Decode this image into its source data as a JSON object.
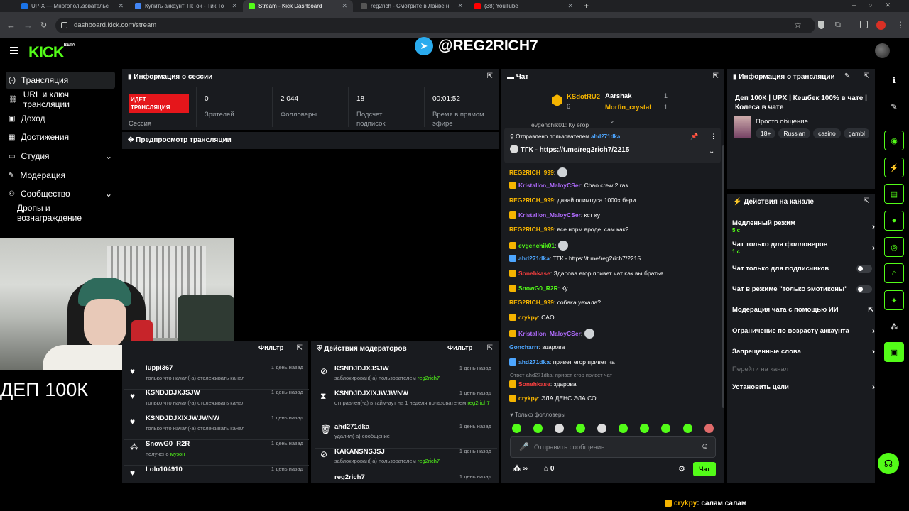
{
  "browser": {
    "tabs": [
      {
        "title": "UP-X — Многопользовательс",
        "icon": "upx-favicon",
        "color": "#1a73e8"
      },
      {
        "title": "Купить аккаунт TikTok - Тик То",
        "icon": "f-favicon",
        "color": "#4285f4"
      },
      {
        "title": "Stream - Kick Dashboard",
        "icon": "kick-favicon",
        "color": "#53fc18"
      },
      {
        "title": "reg2rich - Смотрите в Лайве н",
        "icon": "kick-favicon",
        "color": "#222"
      },
      {
        "title": "(38) YouTube",
        "icon": "youtube-favicon",
        "color": "#ff0000"
      }
    ],
    "url": "dashboard.kick.com/stream"
  },
  "brand": {
    "logo": "KICK",
    "beta": "BETA",
    "accent": "#53fc18"
  },
  "overlay_handle": "@REG2RICH7",
  "sidebar": {
    "items": [
      {
        "label": "Трансляция",
        "icon": "broadcast-icon"
      },
      {
        "label": "URL и ключ трансляции",
        "icon": "link-icon"
      },
      {
        "label": "Доход",
        "icon": "money-icon"
      },
      {
        "label": "Достижения",
        "icon": "achievements-icon"
      },
      {
        "label": "Студия",
        "icon": "studio-icon"
      },
      {
        "label": "Модерация",
        "icon": "moderation-icon"
      },
      {
        "label": "Сообщество",
        "icon": "community-icon"
      },
      {
        "label": "Дропы и вознаграждение",
        "icon": ""
      }
    ]
  },
  "session": {
    "title": "Информация о сессии",
    "live_badge": "ИДЕТ ТРАНСЛЯЦИЯ",
    "session_label": "Сессия",
    "stats": [
      {
        "value": "0",
        "label": "Зрителей"
      },
      {
        "value": "2 044",
        "label": "Фолловеры"
      },
      {
        "value": "18",
        "label": "Подсчет подписок"
      },
      {
        "value": "00:01:52",
        "label": "Время в прямом эфире"
      }
    ]
  },
  "preview": {
    "title": "Предпросмотр трансляции"
  },
  "webcam_caption": "ДЕП 100К",
  "activity": {
    "filter": "Фильтр",
    "items": [
      {
        "name": "luppi367",
        "desc": "только что начал(-а) отслеживать канал",
        "time": "1 день назад",
        "icon": "heart-icon"
      },
      {
        "name": "KSNDJDJXJSJW",
        "desc": "только что начал(-а) отслеживать канал",
        "time": "1 день назад",
        "icon": "heart-icon"
      },
      {
        "name": "KSNDJDJXIXJWJWNW",
        "desc": "только что начал(-а) отслеживать канал",
        "time": "1 день назад",
        "icon": "heart-icon"
      },
      {
        "name": "SnowG0_R2R",
        "desc": "получено",
        "desc_hl": "музон",
        "time": "1 день назад",
        "icon": "gift-icon"
      },
      {
        "name": "Lolo104910",
        "desc": "",
        "time": "1 день назад",
        "icon": "heart-icon"
      }
    ]
  },
  "mod_actions": {
    "title": "Действия модераторов",
    "filter": "Фильтр",
    "items": [
      {
        "name": "KSNDJDJXJSJW",
        "desc": "заблокирован(-а) пользователем",
        "who": "reg2rich7",
        "time": "1 день назад",
        "icon": "ban-icon"
      },
      {
        "name": "KSNDJDJXIXJWJWNW",
        "desc": "отправлен(-а) в тайм-аут на 1 неделя пользователем",
        "who": "reg2rich7",
        "time": "1 день назад",
        "icon": "hourglass-icon"
      },
      {
        "name": "ahd271dka",
        "desc": "удалил(-а) сообщение",
        "who": "",
        "time": "1 день назад",
        "icon": "trash-icon"
      },
      {
        "name": "KAKANSNSJSJ",
        "desc": "заблокирован(-а) пользователем",
        "who": "reg2rich7",
        "time": "1 день назад",
        "icon": "ban-icon"
      },
      {
        "name": "reg2rich7",
        "desc": "",
        "who": "",
        "time": "1 день назад",
        "icon": "ban-icon"
      }
    ]
  },
  "chat": {
    "title": "Чат",
    "leaders": [
      {
        "name": "KSdotRU2",
        "count": "6",
        "extra": ""
      },
      {
        "name": "Aarshak",
        "count": "",
        "extra": "1"
      },
      {
        "name": "Morfin_crystal",
        "count": "",
        "extra": "1"
      }
    ],
    "pinned": {
      "label": "Отправлено пользователем",
      "user": "ahd271dka",
      "text": "ТГК - ",
      "link": "https://t.me/reg2rich7/2215"
    },
    "cut_top": "evgenchik01: Ку егор",
    "messages": [
      {
        "user": "REG2RICH_999",
        "cls": "u-y",
        "text": ""
      },
      {
        "user": "Kristallon_MaloyCSer",
        "cls": "u-p",
        "text": "Chao crew 2 газ"
      },
      {
        "user": "REG2RICH_999",
        "cls": "u-y",
        "text": "давай олимпуса 1000x бери"
      },
      {
        "user": "Kristallon_MaloyCSer",
        "cls": "u-p",
        "text": "кст ку"
      },
      {
        "user": "REG2RICH_999",
        "cls": "u-y",
        "text": "все норм вроде, сам как?"
      },
      {
        "user": "evgenchik01",
        "cls": "u-g",
        "text": ""
      },
      {
        "user": "ahd271dka",
        "cls": "u-b",
        "text": "ТГК - https://t.me/reg2rich7/2215"
      },
      {
        "user": "Sonehkase",
        "cls": "u-r",
        "text": "Здарова егор привет чат как вы братья"
      },
      {
        "user": "SnowG0_R2R",
        "cls": "u-g",
        "text": "Ку"
      },
      {
        "user": "REG2RICH_999",
        "cls": "u-y",
        "text": "собака уехала?"
      },
      {
        "user": "crykpy",
        "cls": "u-y",
        "text": "CAO"
      },
      {
        "user": "Kristallon_MaloyCSer",
        "cls": "u-p",
        "text": ""
      },
      {
        "user": "Goncharrr",
        "cls": "u-b",
        "text": "здарова"
      },
      {
        "user": "ahd271dka",
        "cls": "u-b",
        "text": "привет егор привет чат"
      },
      {
        "user": "Sonehkase",
        "cls": "u-r",
        "text": "здарова"
      },
      {
        "user": "crykpy",
        "cls": "u-y",
        "text": "ЭЛА ДЕНС ЭЛА СО"
      }
    ],
    "reply_ref": "Ответ ahd271dka: привет егор привет чат",
    "followers_only": "Только фолловеры",
    "input_placeholder": "Отправить сообщение",
    "infinity_count": "∞",
    "chest_count": "0",
    "send_label": "Чат"
  },
  "stream_info": {
    "title": "Информация о трансляции",
    "stream_title": "Деп 100К | UPX | Кешбек 100% в чате | Колеса в чате",
    "category": "Просто общение",
    "tags": [
      "18+",
      "Russian",
      "casino",
      "gambl"
    ]
  },
  "channel_actions": {
    "title": "Действия на канале",
    "items": [
      {
        "label": "Медленный режим",
        "sub": "5 с",
        "control": "chevron"
      },
      {
        "label": "Чат только для фолловеров",
        "sub": "1 с",
        "control": "chevron"
      },
      {
        "label": "Чат только для подписчиков",
        "sub": "",
        "control": "toggle"
      },
      {
        "label": "Чат в режиме \"только эмотиконы\"",
        "sub": "",
        "control": "toggle"
      },
      {
        "label": "Модерация чата с помощью ИИ",
        "sub": "",
        "control": "external"
      },
      {
        "label": "Ограничение по возрасту аккаунта",
        "sub": "",
        "control": "chevron"
      },
      {
        "label": "Запрещенные слова",
        "sub": "",
        "control": "chevron"
      },
      {
        "label": "Перейти на канал",
        "sub": "",
        "control": "none"
      },
      {
        "label": "Установить цели",
        "sub": "",
        "control": "chevron"
      }
    ]
  },
  "bottom_overlay": {
    "user": "crykpy",
    "text": ": салам салам"
  }
}
